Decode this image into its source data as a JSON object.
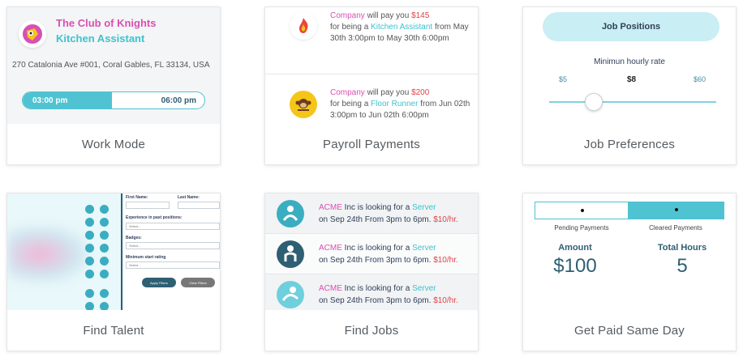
{
  "cards": {
    "work_mode": {
      "caption": "Work Mode",
      "company": "The Club of Knights",
      "role": "Kitchen Assistant",
      "address": "270 Catalonia Ave #001, Coral Gables, FL 33134, USA",
      "start_time": "03:00 pm",
      "end_time": "06:00 pm",
      "progress": 0.49
    },
    "payroll": {
      "caption": "Payroll Payments",
      "items": [
        {
          "company": "Company",
          "will_pay": " will pay you ",
          "amount": "$145",
          "for_being": "for being a ",
          "role": "Kitchen Assistant",
          "from": " from May 30th 3:00pm to May 30th 6:00pm"
        },
        {
          "company": "Company",
          "will_pay": " will pay you ",
          "amount": "$200",
          "for_being": "for being a ",
          "role": "Floor Runner",
          "from": " from Jun 02th 3:00pm to Jun 02th 6:00pm"
        }
      ]
    },
    "job_preferences": {
      "caption": "Job Preferences",
      "button": "Job Positions",
      "rate_label": "Minimun hourly rate",
      "min": "$5",
      "current": "$8",
      "max": "$60"
    },
    "find_talent": {
      "caption": "Find Talent",
      "first_name": "First Name:",
      "last_name": "Last Name:",
      "experience": "Experience in past positions:",
      "badges": "Badges:",
      "rating": "Minimum start rating",
      "select": "Select...",
      "apply": "Apply Filters",
      "clear": "Clear Filters"
    },
    "find_jobs": {
      "caption": "Find Jobs",
      "items": [
        {
          "company": "ACME",
          "looking": " Inc is looking for a ",
          "role": "Server",
          "date": "on Sep 24th From 3pm to 6pm. ",
          "rate": "$10/hr."
        },
        {
          "company": "ACME",
          "looking": " Inc is looking for a ",
          "role": "Server",
          "date": "on Sep 24th From 3pm to 6pm. ",
          "rate": "$10/hr."
        },
        {
          "company": "ACME",
          "looking": " Inc is looking for a ",
          "role": "Server",
          "date": "on Sep 24th From 3pm to 6pm. ",
          "rate": "$10/hr."
        }
      ]
    },
    "get_paid": {
      "caption": "Get Paid Same Day",
      "tab_pending": "Pending Payments",
      "tab_cleared": "Cleared Payments",
      "amount_label": "Amount",
      "amount_value": "$100",
      "hours_label": "Total Hours",
      "hours_value": "5"
    }
  },
  "colors": {
    "pink": "#d94fb4",
    "teal": "#3cc3cf",
    "red": "#e0434a",
    "navy": "#2f5f73"
  }
}
